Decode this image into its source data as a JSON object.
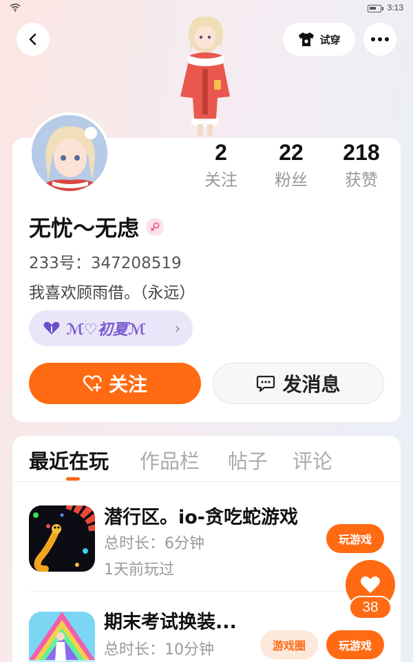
{
  "status_bar": {
    "time": "3:13",
    "wifi_icon": "wifi-icon",
    "battery_icon": "battery-icon"
  },
  "header": {
    "back_icon": "chevron-left-icon",
    "tryon_label": "试穿",
    "tryon_icon": "shirt-icon",
    "more_icon": "more-dots-icon"
  },
  "profile": {
    "stats": [
      {
        "value": "2",
        "label": "关注"
      },
      {
        "value": "22",
        "label": "粉丝"
      },
      {
        "value": "218",
        "label": "获赞"
      }
    ],
    "username": "无忧～无虑",
    "gender_icon": "female-icon",
    "uid": "233号：347208519",
    "bio": "我喜欢顾雨借。（永远）",
    "club_name": "ℳ♡初夏ℳ",
    "club_icon": "heart-hands-icon",
    "follow_label": "关注",
    "message_label": "发消息"
  },
  "tabs": [
    {
      "label": "最近在玩",
      "active": true
    },
    {
      "label": "作品栏",
      "active": false
    },
    {
      "label": "帖子",
      "active": false
    },
    {
      "label": "评论",
      "active": false
    }
  ],
  "games": [
    {
      "title": "潜行区。io-贪吃蛇游戏",
      "duration": "总时长：6分钟",
      "last_played": "1天前玩过",
      "play_label": "玩游戏"
    },
    {
      "title": "期末考试换装...",
      "duration": "总时长：10分钟",
      "circle_label": "游戏圈",
      "play_label": "玩游戏"
    }
  ],
  "like_fab": {
    "count": "38",
    "icon": "heart-icon"
  },
  "colors": {
    "accent": "#ff6a13",
    "club_bg": "#e9e6fa",
    "club_text": "#7a5ad0"
  }
}
